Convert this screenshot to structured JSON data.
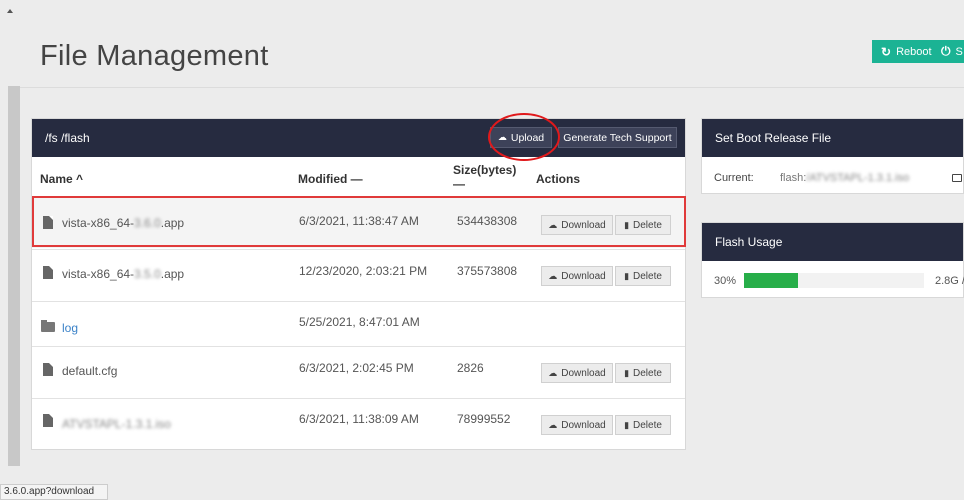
{
  "page": {
    "title": "File Management"
  },
  "header_buttons": {
    "reboot": "Reboot",
    "shutdown": "S"
  },
  "files_panel": {
    "path": "/fs /flash",
    "upload_label": "Upload",
    "tech_support_label": "Generate Tech Support",
    "columns": {
      "name": "Name ^",
      "modified": "Modified —",
      "size_line1": "Size(bytes)",
      "size_line2": "—",
      "actions": "Actions"
    },
    "download_label": "Download",
    "delete_label": "Delete",
    "rows": [
      {
        "name_prefix": "vista-x86_64-",
        "name_blur": "3.6.0",
        "name_suffix": ".app",
        "modified": "6/3/2021, 11:38:47 AM",
        "size": "534438308",
        "type": "file"
      },
      {
        "name_prefix": "vista-x86_64-",
        "name_blur": "3.5.0",
        "name_suffix": ".app",
        "modified": "12/23/2020, 2:03:21 PM",
        "size": "375573808",
        "type": "file"
      },
      {
        "name_prefix": "log",
        "name_blur": "",
        "name_suffix": "",
        "modified": "5/25/2021, 8:47:01 AM",
        "size": "",
        "type": "folder"
      },
      {
        "name_prefix": "default.cfg",
        "name_blur": "",
        "name_suffix": "",
        "modified": "6/3/2021, 2:02:45 PM",
        "size": "2826",
        "type": "file"
      },
      {
        "name_prefix": "",
        "name_blur": "ATVSTAPL-1.3.1.iso",
        "name_suffix": "",
        "modified": "6/3/2021, 11:38:09 AM",
        "size": "78999552",
        "type": "file"
      }
    ]
  },
  "boot_panel": {
    "title": "Set Boot Release File",
    "current_label": "Current:",
    "current_prefix": "flash:",
    "current_blur": "/ATVSTAPL-1.3.1.iso"
  },
  "usage_panel": {
    "title": "Flash Usage",
    "percent_label": "30%",
    "percent": 30,
    "amount": "2.8G / ..."
  },
  "status_bar": {
    "text": "3.6.0.app?download"
  },
  "colors": {
    "header_bg": "#262b40",
    "accent_green": "#1bb394",
    "usage_green": "#27ae49",
    "annotation_red": "#e0191b"
  },
  "icons": {
    "reboot": "power-cycle-icon",
    "upload": "cloud-upload-icon",
    "download": "cloud-download-icon",
    "delete": "trash-icon",
    "file": "file-icon",
    "folder": "folder-icon"
  }
}
